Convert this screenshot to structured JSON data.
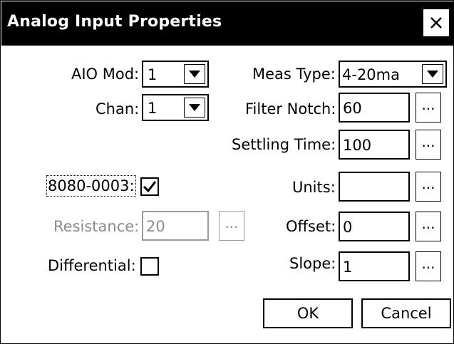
{
  "window": {
    "title": "Analog Input Properties"
  },
  "fields": {
    "aio_mod": {
      "label": "AIO Mod:",
      "value": "1"
    },
    "chan": {
      "label": "Chan:",
      "value": "1"
    },
    "meas_type": {
      "label": "Meas Type:",
      "value": "4-20ma"
    },
    "filter_notch": {
      "label": "Filter Notch:",
      "value": "60"
    },
    "settling_time": {
      "label": "Settling Time:",
      "value": "100"
    },
    "module_check": {
      "label": "8080-0003:",
      "checked": true
    },
    "units": {
      "label": "Units:",
      "value": ""
    },
    "resistance": {
      "label": "Resistance:",
      "value": "20",
      "disabled": true
    },
    "offset": {
      "label": "Offset:",
      "value": "0"
    },
    "differential": {
      "label": "Differential:",
      "checked": false
    },
    "slope": {
      "label": "Slope:",
      "value": "1"
    }
  },
  "ellipsis": "...",
  "buttons": {
    "ok": "OK",
    "cancel": "Cancel"
  },
  "icons": {
    "close": "close-icon",
    "dropdown": "dropdown-arrow-icon",
    "check": "check-icon"
  }
}
